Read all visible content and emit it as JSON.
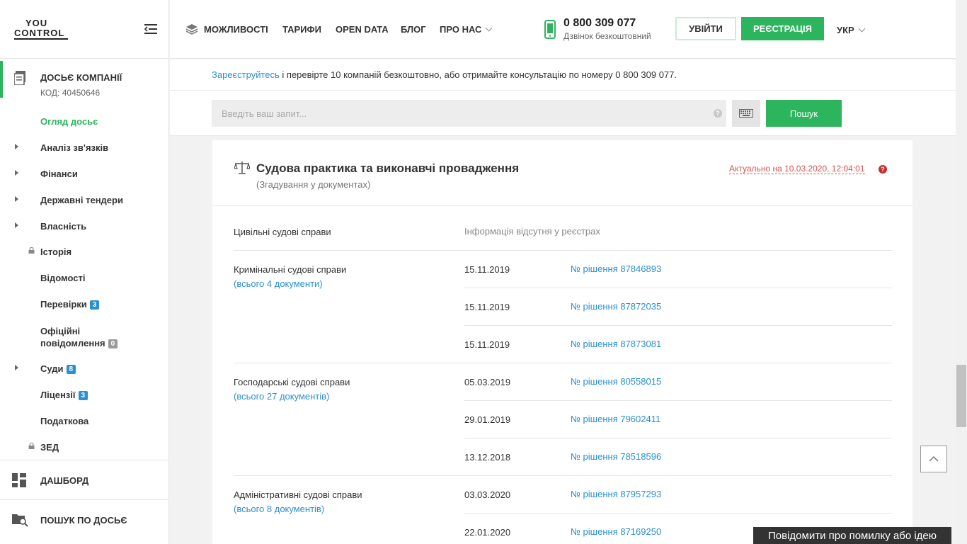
{
  "logo": {
    "line1": "YOU",
    "line2": "CONTROL"
  },
  "sidebar": {
    "dossier_title": "ДОСЬЄ КОМПАНІЇ",
    "dossier_code": "КОД: 40450646",
    "items": [
      {
        "label": "Огляд досьє"
      },
      {
        "label": "Аналіз зв'язків"
      },
      {
        "label": "Фінанси"
      },
      {
        "label": "Державні тендери"
      },
      {
        "label": "Власність"
      },
      {
        "label": "Історія"
      },
      {
        "label": "Відомості"
      },
      {
        "label": "Перевірки",
        "badge": "3"
      },
      {
        "label_line1": "Офіційні",
        "label_line2": "повідомлення",
        "badge": "0"
      },
      {
        "label": "Суди",
        "badge": "8"
      },
      {
        "label": "Ліцензії",
        "badge": "3"
      },
      {
        "label": "Податкова"
      },
      {
        "label": "ЗЕД"
      }
    ],
    "dashboard": "ДАШБОРД",
    "search_dossier": "ПОШУК ПО ДОСЬЄ"
  },
  "header": {
    "nav": [
      "МОЖЛИВОСТІ",
      "ТАРИФИ",
      "OPEN DATA",
      "БЛОГ",
      "ПРО НАС"
    ],
    "phone": "0 800 309 077",
    "phone_sub": "Дзвінок безкоштовний",
    "login": "УВІЙТИ",
    "register": "РЕЄСТРАЦІЯ",
    "lang": "УКР"
  },
  "infobar": {
    "link": "Зареєструйтесь",
    "text": " і перевірте 10 компаній безкоштовно, або отримайте консультацію по номеру 0 800 309 077."
  },
  "search": {
    "placeholder": "Введіть ваш запит...",
    "help": "?",
    "button": "Пошук"
  },
  "card": {
    "title": "Судова практика та виконавчі провадження",
    "subtitle": "(Згадування у документах)",
    "actual": "Актуально на 10.03.2020, 12:04:01",
    "actual_help": "?",
    "civil": {
      "label": "Цивільні судові справи",
      "value": "Інформація відсутня у реєстрах"
    },
    "criminal": {
      "label": "Кримінальні судові справи",
      "link": "(всього 4 документи)",
      "rows": [
        {
          "date": "15.11.2019",
          "doc": "№ рішення 87846893"
        },
        {
          "date": "15.11.2019",
          "doc": "№ рішення 87872035"
        },
        {
          "date": "15.11.2019",
          "doc": "№ рішення 87873081"
        }
      ]
    },
    "commercial": {
      "label": "Господарські судові справи",
      "link": "(всього 27 документів)",
      "rows": [
        {
          "date": "05.03.2019",
          "doc": "№ рішення 80558015"
        },
        {
          "date": "29.01.2019",
          "doc": "№ рішення 79602411"
        },
        {
          "date": "13.12.2018",
          "doc": "№ рішення 78518596"
        }
      ]
    },
    "administrative": {
      "label": "Адміністративні судові справи",
      "link": "(всього 8 документів)",
      "rows": [
        {
          "date": "03.03.2020",
          "doc": "№ рішення 87957293"
        },
        {
          "date": "22.01.2020",
          "doc": "№ рішення 87169250"
        }
      ]
    }
  },
  "report": "Повідомити про помилку або ідею",
  "colors": {
    "accent": "#2db55d",
    "link": "#2b8fd0",
    "warning": "#d9534f"
  }
}
